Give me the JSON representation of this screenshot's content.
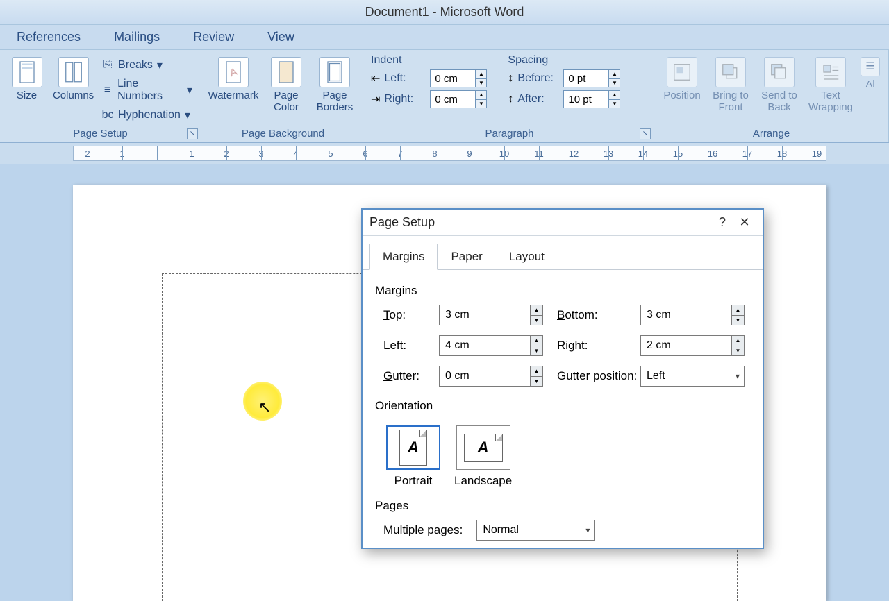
{
  "window": {
    "title": "Document1 - Microsoft Word"
  },
  "ribbon_tabs": {
    "references": "References",
    "mailings": "Mailings",
    "review": "Review",
    "view": "View"
  },
  "ribbon": {
    "page_setup": {
      "label": "Page Setup",
      "size": "Size",
      "columns": "Columns",
      "breaks": "Breaks",
      "line_numbers": "Line Numbers",
      "hyphenation": "Hyphenation"
    },
    "page_background": {
      "label": "Page Background",
      "watermark": "Watermark",
      "page_color": "Page Color",
      "page_borders": "Page Borders"
    },
    "paragraph": {
      "label": "Paragraph",
      "indent_title": "Indent",
      "spacing_title": "Spacing",
      "left_label": "Left:",
      "right_label": "Right:",
      "before_label": "Before:",
      "after_label": "After:",
      "left_val": "0 cm",
      "right_val": "0 cm",
      "before_val": "0 pt",
      "after_val": "10 pt"
    },
    "arrange": {
      "label": "Arrange",
      "position": "Position",
      "bring_front": "Bring to Front",
      "send_back": "Send to Back",
      "text_wrap": "Text Wrapping",
      "align": "Al"
    }
  },
  "dialog": {
    "title": "Page Setup",
    "tabs": {
      "margins": "Margins",
      "paper": "Paper",
      "layout": "Layout"
    },
    "margins": {
      "section": "Margins",
      "top_label": "Top:",
      "top_val": "3 cm",
      "bottom_label": "Bottom:",
      "bottom_val": "3 cm",
      "left_label": "Left:",
      "left_val": "4 cm",
      "right_label": "Right:",
      "right_val": "2 cm",
      "gutter_label": "Gutter:",
      "gutter_val": "0 cm",
      "gutter_pos_label": "Gutter position:",
      "gutter_pos_val": "Left"
    },
    "orientation": {
      "section": "Orientation",
      "portrait": "Portrait",
      "landscape": "Landscape"
    },
    "pages": {
      "section": "Pages",
      "multiple_label": "Multiple pages:",
      "multiple_val": "Normal"
    }
  },
  "ruler_numbers": [
    "2",
    "1",
    "",
    "1",
    "2",
    "3",
    "4",
    "5",
    "6",
    "7",
    "8",
    "9",
    "10",
    "11",
    "12",
    "13",
    "14",
    "15",
    "16",
    "17",
    "18",
    "19"
  ]
}
